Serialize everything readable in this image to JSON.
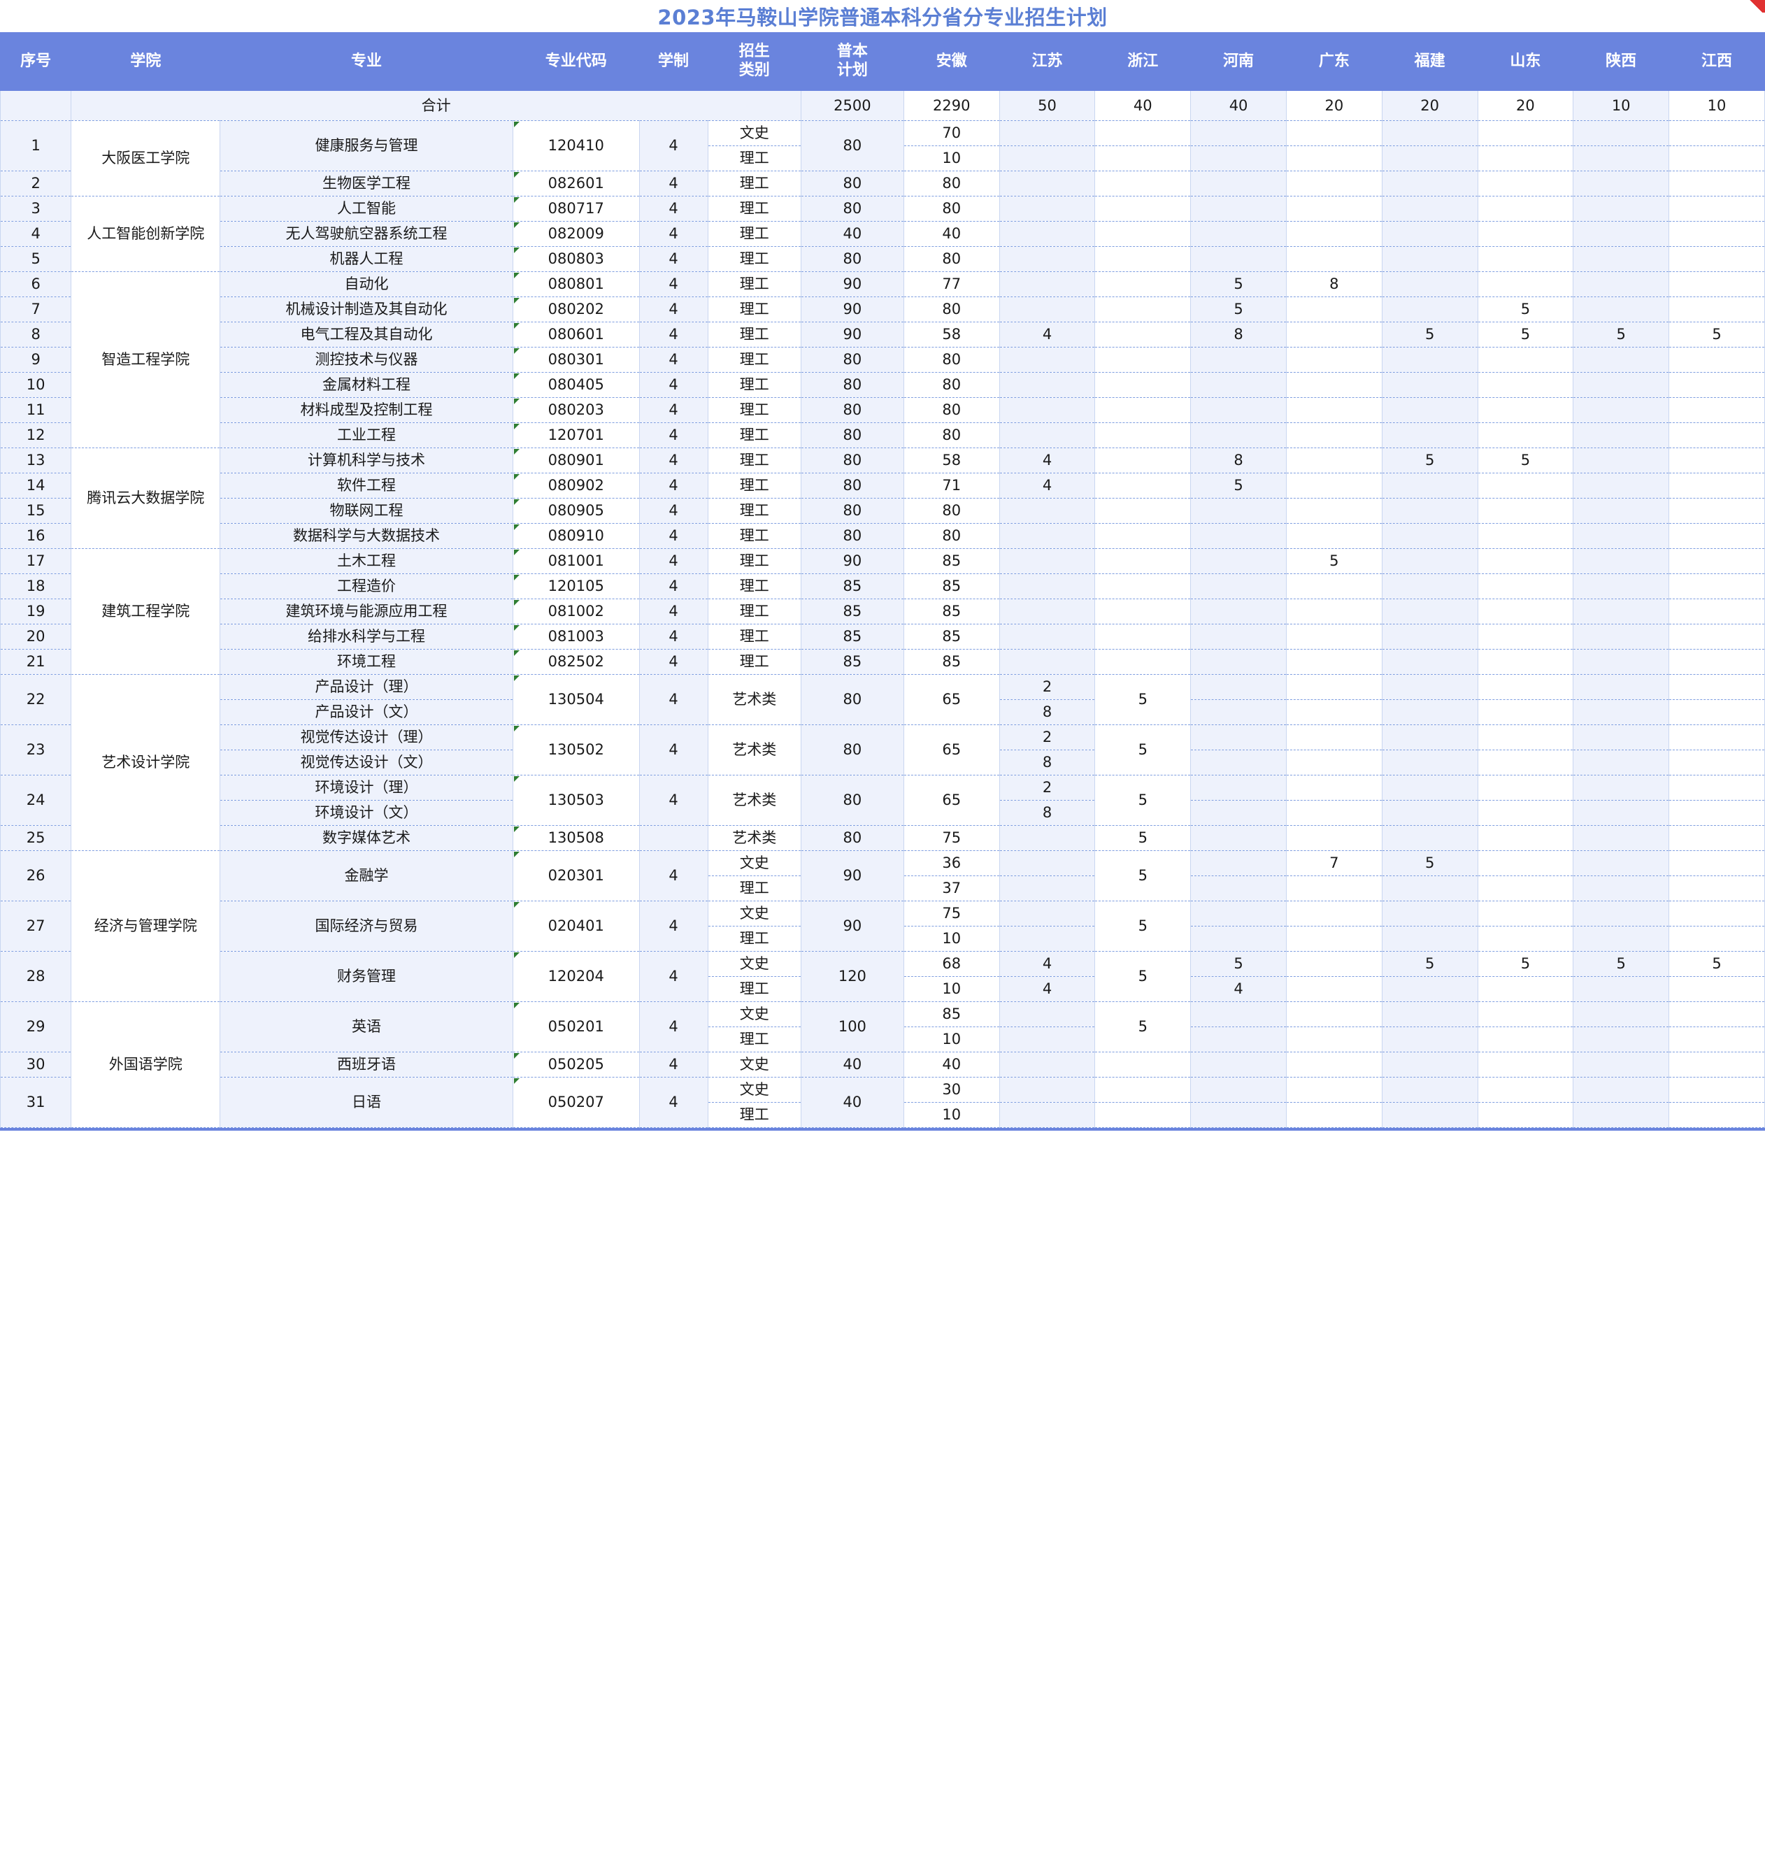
{
  "document": {
    "title": "2023年马鞍山学院普通本科分省分专业招生计划",
    "accent_color": "#6a84de",
    "title_color": "#5b7fd4",
    "band_color": "#eef2fc"
  },
  "table": {
    "columns": [
      {
        "key": "seq",
        "label": "序号"
      },
      {
        "key": "college",
        "label": "学院"
      },
      {
        "key": "major",
        "label": "专业"
      },
      {
        "key": "code",
        "label": "专业代码"
      },
      {
        "key": "years",
        "label": "学制"
      },
      {
        "key": "cat",
        "label": "招生\n类别",
        "line1": "招生",
        "line2": "类别"
      },
      {
        "key": "plan",
        "label": "普本\n计划",
        "line1": "普本",
        "line2": "计划"
      },
      {
        "key": "anhui",
        "label": "安徽"
      },
      {
        "key": "jiangsu",
        "label": "江苏"
      },
      {
        "key": "zhejiang",
        "label": "浙江"
      },
      {
        "key": "henan",
        "label": "河南"
      },
      {
        "key": "guangdong",
        "label": "广东"
      },
      {
        "key": "fujian",
        "label": "福建"
      },
      {
        "key": "shandong",
        "label": "山东"
      },
      {
        "key": "shaanxi",
        "label": "陕西"
      },
      {
        "key": "jiangxi",
        "label": "江西"
      }
    ],
    "total_row": {
      "label": "合计",
      "plan": "2500",
      "anhui": "2290",
      "jiangsu": "50",
      "zhejiang": "40",
      "henan": "40",
      "guangdong": "20",
      "fujian": "20",
      "shandong": "20",
      "shaanxi": "10",
      "jiangxi": "10"
    },
    "colleges": [
      {
        "name": "大阪医工学院",
        "rows": [
          1,
          2
        ]
      },
      {
        "name": "人工智能创新学院",
        "rows": [
          3,
          4,
          5
        ]
      },
      {
        "name": "智造工程学院",
        "rows": [
          6,
          7,
          8,
          9,
          10,
          11,
          12
        ]
      },
      {
        "name": "腾讯云大数据学院",
        "rows": [
          13,
          14,
          15,
          16
        ]
      },
      {
        "name": "建筑工程学院",
        "rows": [
          17,
          18,
          19,
          20,
          21
        ]
      },
      {
        "name": "艺术设计学院",
        "rows": [
          22,
          23,
          24,
          25
        ]
      },
      {
        "name": "经济与管理学院",
        "rows": [
          26,
          27,
          28
        ]
      },
      {
        "name": "外国语学院",
        "rows": [
          29,
          30,
          31
        ]
      }
    ],
    "rows": [
      {
        "seq": "1",
        "college": "大阪医工学院",
        "major": "健康服务与管理",
        "code": "120410",
        "years": "4",
        "plan": "80",
        "subs": [
          {
            "cat": "文史",
            "anhui": "70",
            "jiangsu": "",
            "zhejiang": "",
            "henan": "",
            "guangdong": "",
            "fujian": "",
            "shandong": "",
            "shaanxi": "",
            "jiangxi": ""
          },
          {
            "cat": "理工",
            "anhui": "10",
            "jiangsu": "",
            "zhejiang": "",
            "henan": "",
            "guangdong": "",
            "fujian": "",
            "shandong": "",
            "shaanxi": "",
            "jiangxi": ""
          }
        ]
      },
      {
        "seq": "2",
        "college": "大阪医工学院",
        "major": "生物医学工程",
        "code": "082601",
        "years": "4",
        "plan": "80",
        "subs": [
          {
            "cat": "理工",
            "anhui": "80",
            "jiangsu": "",
            "zhejiang": "",
            "henan": "",
            "guangdong": "",
            "fujian": "",
            "shandong": "",
            "shaanxi": "",
            "jiangxi": ""
          }
        ]
      },
      {
        "seq": "3",
        "college": "人工智能创新学院",
        "major": "人工智能",
        "code": "080717",
        "years": "4",
        "plan": "80",
        "subs": [
          {
            "cat": "理工",
            "anhui": "80",
            "jiangsu": "",
            "zhejiang": "",
            "henan": "",
            "guangdong": "",
            "fujian": "",
            "shandong": "",
            "shaanxi": "",
            "jiangxi": ""
          }
        ]
      },
      {
        "seq": "4",
        "college": "人工智能创新学院",
        "major": "无人驾驶航空器系统工程",
        "code": "082009",
        "years": "4",
        "plan": "40",
        "subs": [
          {
            "cat": "理工",
            "anhui": "40",
            "jiangsu": "",
            "zhejiang": "",
            "henan": "",
            "guangdong": "",
            "fujian": "",
            "shandong": "",
            "shaanxi": "",
            "jiangxi": ""
          }
        ]
      },
      {
        "seq": "5",
        "college": "人工智能创新学院",
        "major": "机器人工程",
        "code": "080803",
        "years": "4",
        "plan": "80",
        "subs": [
          {
            "cat": "理工",
            "anhui": "80",
            "jiangsu": "",
            "zhejiang": "",
            "henan": "",
            "guangdong": "",
            "fujian": "",
            "shandong": "",
            "shaanxi": "",
            "jiangxi": ""
          }
        ]
      },
      {
        "seq": "6",
        "college": "智造工程学院",
        "major": "自动化",
        "code": "080801",
        "years": "4",
        "plan": "90",
        "subs": [
          {
            "cat": "理工",
            "anhui": "77",
            "jiangsu": "",
            "zhejiang": "",
            "henan": "5",
            "guangdong": "8",
            "fujian": "",
            "shandong": "",
            "shaanxi": "",
            "jiangxi": ""
          }
        ]
      },
      {
        "seq": "7",
        "college": "智造工程学院",
        "major": "机械设计制造及其自动化",
        "code": "080202",
        "years": "4",
        "plan": "90",
        "subs": [
          {
            "cat": "理工",
            "anhui": "80",
            "jiangsu": "",
            "zhejiang": "",
            "henan": "5",
            "guangdong": "",
            "fujian": "",
            "shandong": "5",
            "shaanxi": "",
            "jiangxi": ""
          }
        ]
      },
      {
        "seq": "8",
        "college": "智造工程学院",
        "major": "电气工程及其自动化",
        "code": "080601",
        "years": "4",
        "plan": "90",
        "subs": [
          {
            "cat": "理工",
            "anhui": "58",
            "jiangsu": "4",
            "zhejiang": "",
            "henan": "8",
            "guangdong": "",
            "fujian": "5",
            "shandong": "5",
            "shaanxi": "5",
            "jiangxi": "5"
          }
        ]
      },
      {
        "seq": "9",
        "college": "智造工程学院",
        "major": "测控技术与仪器",
        "code": "080301",
        "years": "4",
        "plan": "80",
        "subs": [
          {
            "cat": "理工",
            "anhui": "80",
            "jiangsu": "",
            "zhejiang": "",
            "henan": "",
            "guangdong": "",
            "fujian": "",
            "shandong": "",
            "shaanxi": "",
            "jiangxi": ""
          }
        ]
      },
      {
        "seq": "10",
        "college": "智造工程学院",
        "major": "金属材料工程",
        "code": "080405",
        "years": "4",
        "plan": "80",
        "subs": [
          {
            "cat": "理工",
            "anhui": "80",
            "jiangsu": "",
            "zhejiang": "",
            "henan": "",
            "guangdong": "",
            "fujian": "",
            "shandong": "",
            "shaanxi": "",
            "jiangxi": ""
          }
        ]
      },
      {
        "seq": "11",
        "college": "智造工程学院",
        "major": "材料成型及控制工程",
        "code": "080203",
        "years": "4",
        "plan": "80",
        "subs": [
          {
            "cat": "理工",
            "anhui": "80",
            "jiangsu": "",
            "zhejiang": "",
            "henan": "",
            "guangdong": "",
            "fujian": "",
            "shandong": "",
            "shaanxi": "",
            "jiangxi": ""
          }
        ]
      },
      {
        "seq": "12",
        "college": "智造工程学院",
        "major": "工业工程",
        "code": "120701",
        "years": "4",
        "plan": "80",
        "subs": [
          {
            "cat": "理工",
            "anhui": "80",
            "jiangsu": "",
            "zhejiang": "",
            "henan": "",
            "guangdong": "",
            "fujian": "",
            "shandong": "",
            "shaanxi": "",
            "jiangxi": ""
          }
        ]
      },
      {
        "seq": "13",
        "college": "腾讯云大数据学院",
        "major": "计算机科学与技术",
        "code": "080901",
        "years": "4",
        "plan": "80",
        "subs": [
          {
            "cat": "理工",
            "anhui": "58",
            "jiangsu": "4",
            "zhejiang": "",
            "henan": "8",
            "guangdong": "",
            "fujian": "5",
            "shandong": "5",
            "shaanxi": "",
            "jiangxi": ""
          }
        ]
      },
      {
        "seq": "14",
        "college": "腾讯云大数据学院",
        "major": "软件工程",
        "code": "080902",
        "years": "4",
        "plan": "80",
        "subs": [
          {
            "cat": "理工",
            "anhui": "71",
            "jiangsu": "4",
            "zhejiang": "",
            "henan": "5",
            "guangdong": "",
            "fujian": "",
            "shandong": "",
            "shaanxi": "",
            "jiangxi": ""
          }
        ]
      },
      {
        "seq": "15",
        "college": "腾讯云大数据学院",
        "major": "物联网工程",
        "code": "080905",
        "years": "4",
        "plan": "80",
        "subs": [
          {
            "cat": "理工",
            "anhui": "80",
            "jiangsu": "",
            "zhejiang": "",
            "henan": "",
            "guangdong": "",
            "fujian": "",
            "shandong": "",
            "shaanxi": "",
            "jiangxi": ""
          }
        ]
      },
      {
        "seq": "16",
        "college": "腾讯云大数据学院",
        "major": "数据科学与大数据技术",
        "code": "080910",
        "years": "4",
        "plan": "80",
        "subs": [
          {
            "cat": "理工",
            "anhui": "80",
            "jiangsu": "",
            "zhejiang": "",
            "henan": "",
            "guangdong": "",
            "fujian": "",
            "shandong": "",
            "shaanxi": "",
            "jiangxi": ""
          }
        ]
      },
      {
        "seq": "17",
        "college": "建筑工程学院",
        "major": "土木工程",
        "code": "081001",
        "years": "4",
        "plan": "90",
        "subs": [
          {
            "cat": "理工",
            "anhui": "85",
            "jiangsu": "",
            "zhejiang": "",
            "henan": "",
            "guangdong": "5",
            "fujian": "",
            "shandong": "",
            "shaanxi": "",
            "jiangxi": ""
          }
        ]
      },
      {
        "seq": "18",
        "college": "建筑工程学院",
        "major": "工程造价",
        "code": "120105",
        "years": "4",
        "plan": "85",
        "subs": [
          {
            "cat": "理工",
            "anhui": "85",
            "jiangsu": "",
            "zhejiang": "",
            "henan": "",
            "guangdong": "",
            "fujian": "",
            "shandong": "",
            "shaanxi": "",
            "jiangxi": ""
          }
        ]
      },
      {
        "seq": "19",
        "college": "建筑工程学院",
        "major": "建筑环境与能源应用工程",
        "code": "081002",
        "years": "4",
        "plan": "85",
        "subs": [
          {
            "cat": "理工",
            "anhui": "85",
            "jiangsu": "",
            "zhejiang": "",
            "henan": "",
            "guangdong": "",
            "fujian": "",
            "shandong": "",
            "shaanxi": "",
            "jiangxi": ""
          }
        ]
      },
      {
        "seq": "20",
        "college": "建筑工程学院",
        "major": "给排水科学与工程",
        "code": "081003",
        "years": "4",
        "plan": "85",
        "subs": [
          {
            "cat": "理工",
            "anhui": "85",
            "jiangsu": "",
            "zhejiang": "",
            "henan": "",
            "guangdong": "",
            "fujian": "",
            "shandong": "",
            "shaanxi": "",
            "jiangxi": ""
          }
        ]
      },
      {
        "seq": "21",
        "college": "建筑工程学院",
        "major": "环境工程",
        "code": "082502",
        "years": "4",
        "plan": "85",
        "subs": [
          {
            "cat": "理工",
            "anhui": "85",
            "jiangsu": "",
            "zhejiang": "",
            "henan": "",
            "guangdong": "",
            "fujian": "",
            "shandong": "",
            "shaanxi": "",
            "jiangxi": ""
          }
        ]
      },
      {
        "seq": "22",
        "college": "艺术设计学院",
        "major_lines": [
          "产品设计（理）",
          "产品设计（文）"
        ],
        "major": "产品设计（理）",
        "code": "130504",
        "years": "4",
        "plan": "80",
        "cat": "艺术类",
        "anhui": "65",
        "zhejiang": "5",
        "subs": [
          {
            "major": "产品设计（理）",
            "jiangsu": "2"
          },
          {
            "major": "产品设计（文）",
            "jiangsu": "8"
          }
        ]
      },
      {
        "seq": "23",
        "college": "艺术设计学院",
        "major_lines": [
          "视觉传达设计（理）",
          "视觉传达设计（文）"
        ],
        "major": "视觉传达设计（理）",
        "code": "130502",
        "years": "4",
        "plan": "80",
        "cat": "艺术类",
        "anhui": "65",
        "zhejiang": "5",
        "subs": [
          {
            "major": "视觉传达设计（理）",
            "jiangsu": "2"
          },
          {
            "major": "视觉传达设计（文）",
            "jiangsu": "8"
          }
        ]
      },
      {
        "seq": "24",
        "college": "艺术设计学院",
        "major_lines": [
          "环境设计（理）",
          "环境设计（文）"
        ],
        "major": "环境设计（理）",
        "code": "130503",
        "years": "4",
        "plan": "80",
        "cat": "艺术类",
        "anhui": "65",
        "zhejiang": "5",
        "subs": [
          {
            "major": "环境设计（理）",
            "jiangsu": "2"
          },
          {
            "major": "环境设计（文）",
            "jiangsu": "8"
          }
        ]
      },
      {
        "seq": "25",
        "college": "艺术设计学院",
        "major": "数字媒体艺术",
        "code": "130508",
        "years": "",
        "plan": "80",
        "cat": "艺术类",
        "subs": [
          {
            "cat": "艺术类",
            "anhui": "75",
            "jiangsu": "",
            "zhejiang": "5",
            "henan": "",
            "guangdong": "",
            "fujian": "",
            "shandong": "",
            "shaanxi": "",
            "jiangxi": ""
          }
        ]
      },
      {
        "seq": "26",
        "college": "经济与管理学院",
        "major": "金融学",
        "code": "020301",
        "years": "4",
        "plan": "90",
        "zhejiang": "5",
        "subs": [
          {
            "cat": "文史",
            "anhui": "36",
            "jiangsu": "",
            "henan": "",
            "guangdong": "7",
            "fujian": "5",
            "shandong": "",
            "shaanxi": "",
            "jiangxi": ""
          },
          {
            "cat": "理工",
            "anhui": "37",
            "jiangsu": "",
            "henan": "",
            "guangdong": "",
            "fujian": "",
            "shandong": "",
            "shaanxi": "",
            "jiangxi": ""
          }
        ]
      },
      {
        "seq": "27",
        "college": "经济与管理学院",
        "major": "国际经济与贸易",
        "code": "020401",
        "years": "4",
        "plan": "90",
        "zhejiang": "5",
        "subs": [
          {
            "cat": "文史",
            "anhui": "75",
            "jiangsu": "",
            "henan": "",
            "guangdong": "",
            "fujian": "",
            "shandong": "",
            "shaanxi": "",
            "jiangxi": ""
          },
          {
            "cat": "理工",
            "anhui": "10",
            "jiangsu": "",
            "henan": "",
            "guangdong": "",
            "fujian": "",
            "shandong": "",
            "shaanxi": "",
            "jiangxi": ""
          }
        ]
      },
      {
        "seq": "28",
        "college": "经济与管理学院",
        "major": "财务管理",
        "code": "120204",
        "years": "4",
        "plan": "120",
        "zhejiang": "5",
        "subs": [
          {
            "cat": "文史",
            "anhui": "68",
            "jiangsu": "4",
            "henan": "5",
            "guangdong": "",
            "fujian": "5",
            "shandong": "5",
            "shaanxi": "5",
            "jiangxi": "5"
          },
          {
            "cat": "理工",
            "anhui": "10",
            "jiangsu": "4",
            "henan": "4",
            "guangdong": "",
            "fujian": "",
            "shandong": "",
            "shaanxi": "",
            "jiangxi": ""
          }
        ]
      },
      {
        "seq": "29",
        "college": "外国语学院",
        "major": "英语",
        "code": "050201",
        "years": "4",
        "plan": "100",
        "zhejiang": "5",
        "subs": [
          {
            "cat": "文史",
            "anhui": "85",
            "jiangsu": "",
            "henan": "",
            "guangdong": "",
            "fujian": "",
            "shandong": "",
            "shaanxi": "",
            "jiangxi": ""
          },
          {
            "cat": "理工",
            "anhui": "10",
            "jiangsu": "",
            "henan": "",
            "guangdong": "",
            "fujian": "",
            "shandong": "",
            "shaanxi": "",
            "jiangxi": ""
          }
        ]
      },
      {
        "seq": "30",
        "college": "外国语学院",
        "major": "西班牙语",
        "code": "050205",
        "years": "4",
        "plan": "40",
        "subs": [
          {
            "cat": "文史",
            "anhui": "40",
            "jiangsu": "",
            "zhejiang": "",
            "henan": "",
            "guangdong": "",
            "fujian": "",
            "shandong": "",
            "shaanxi": "",
            "jiangxi": ""
          }
        ]
      },
      {
        "seq": "31",
        "college": "外国语学院",
        "major": "日语",
        "code": "050207",
        "years": "4",
        "plan": "40",
        "subs": [
          {
            "cat": "文史",
            "anhui": "30",
            "jiangsu": "",
            "zhejiang": "",
            "henan": "",
            "guangdong": "",
            "fujian": "",
            "shandong": "",
            "shaanxi": "",
            "jiangxi": ""
          },
          {
            "cat": "理工",
            "anhui": "10",
            "jiangsu": "",
            "zhejiang": "",
            "henan": "",
            "guangdong": "",
            "fujian": "",
            "shandong": "",
            "shaanxi": "",
            "jiangxi": ""
          }
        ]
      }
    ]
  }
}
